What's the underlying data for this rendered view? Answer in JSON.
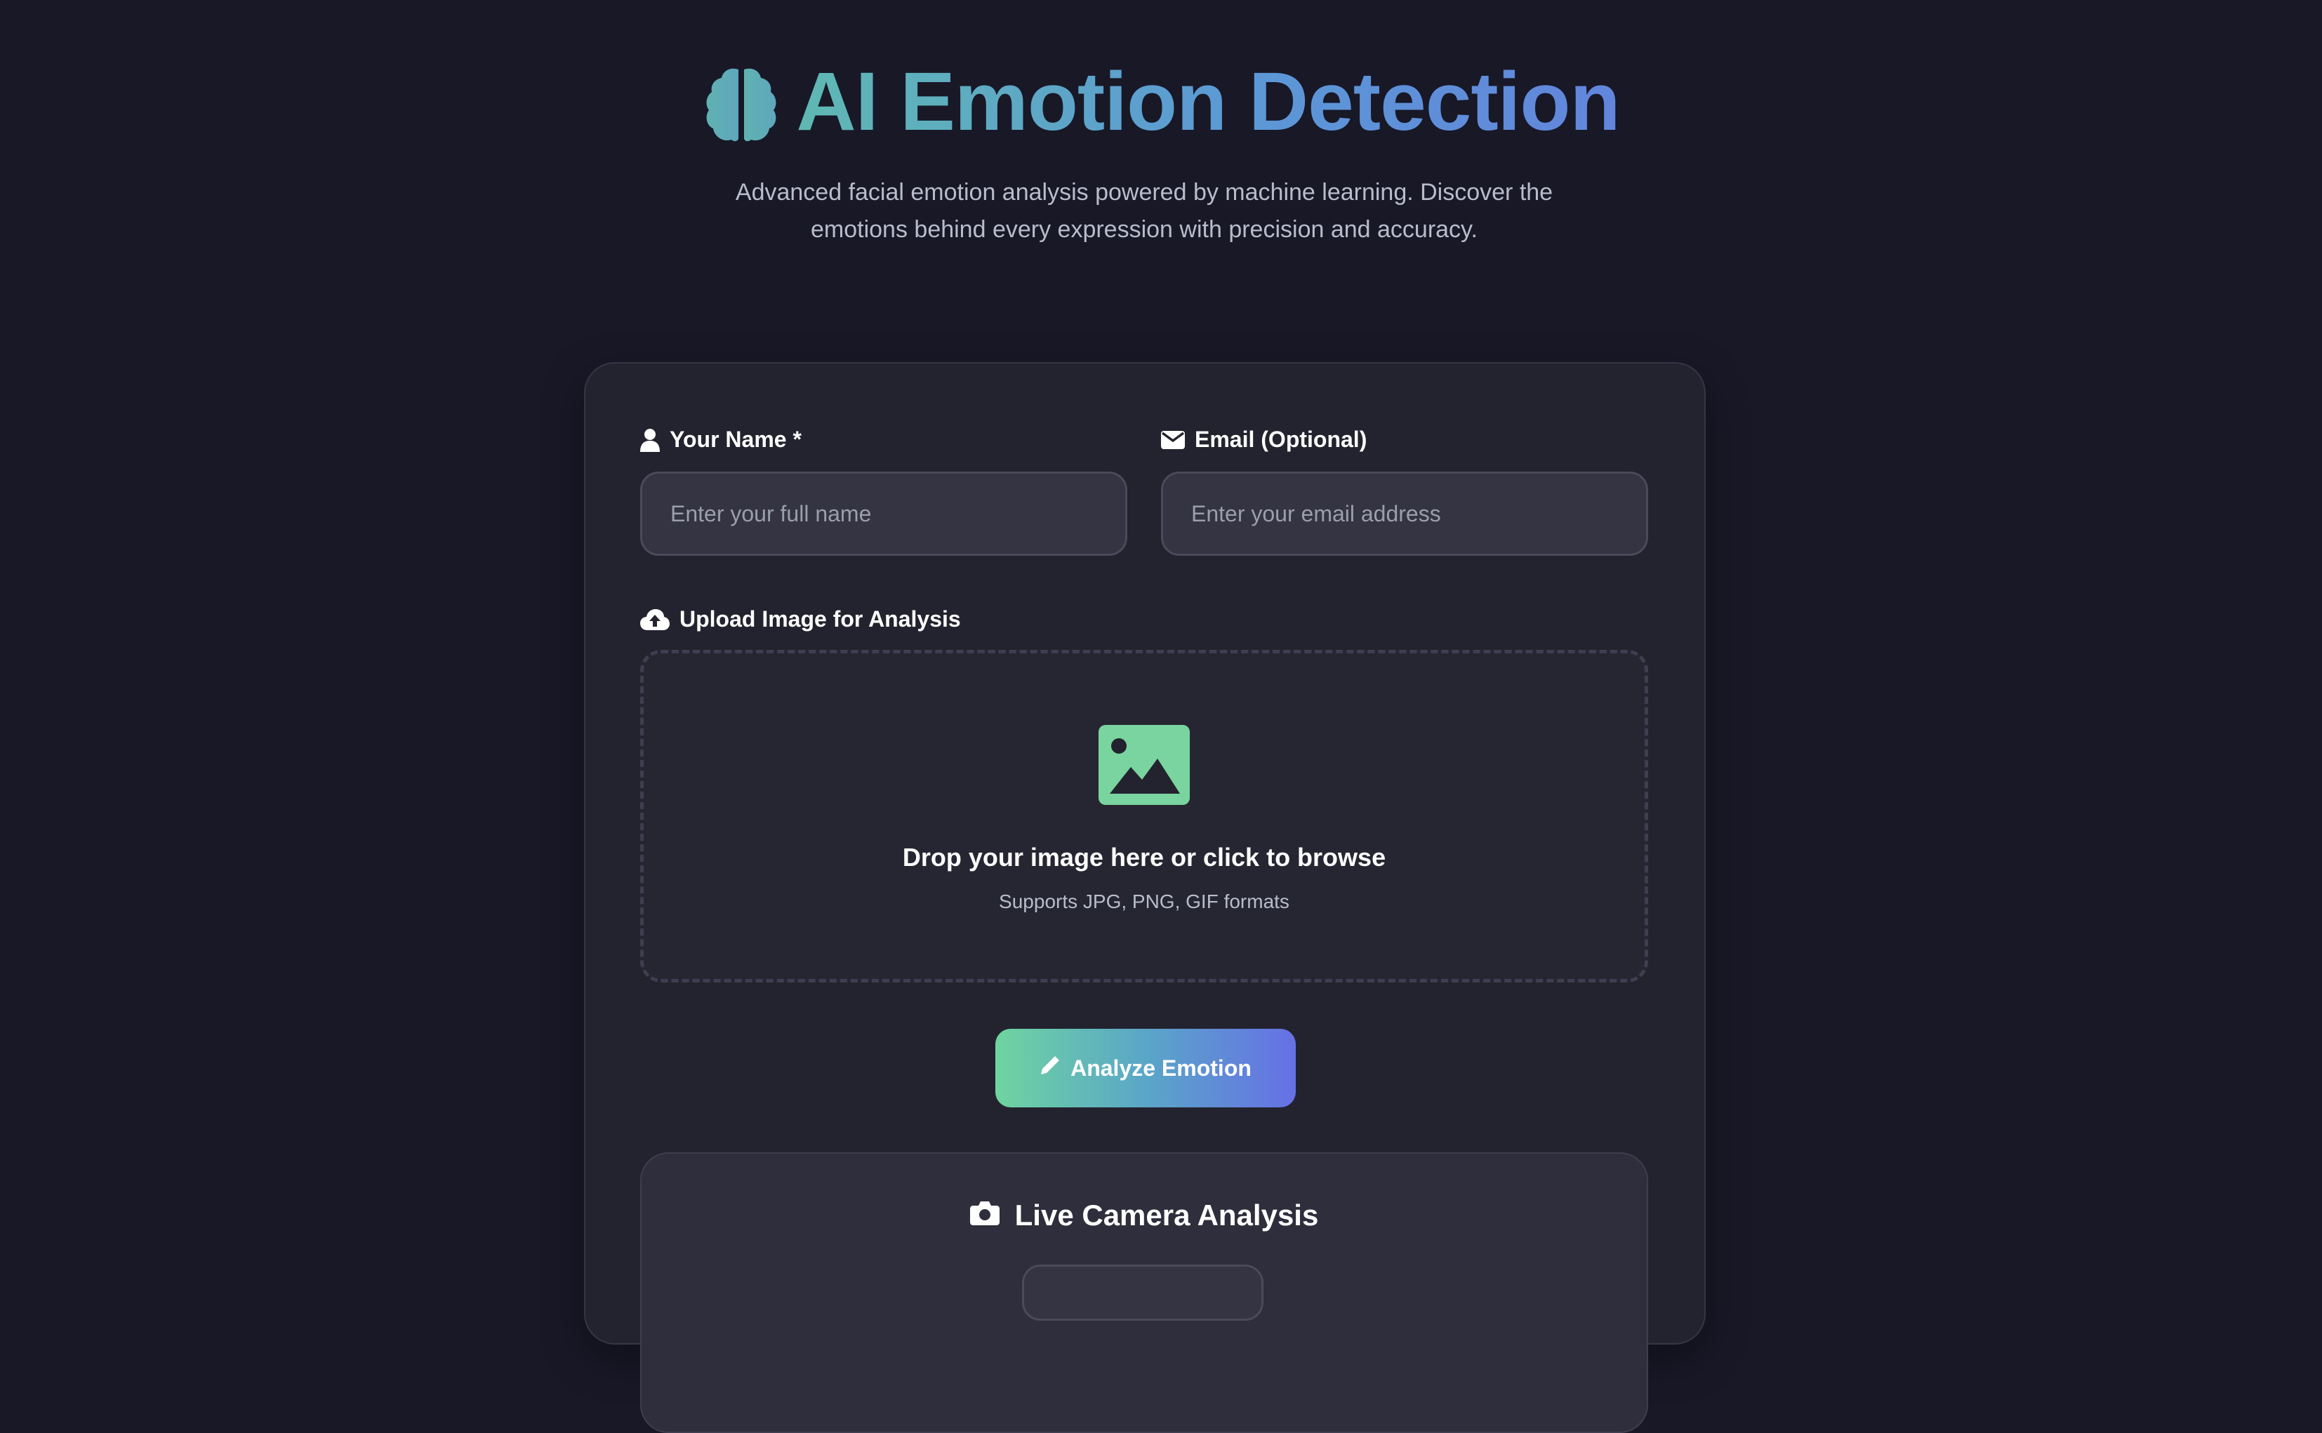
{
  "header": {
    "title": "AI Emotion Detection",
    "subtitle": "Advanced facial emotion analysis powered by machine learning. Discover the emotions behind every expression with precision and accuracy."
  },
  "form": {
    "name": {
      "label": "Your Name *",
      "placeholder": "Enter your full name",
      "icon": "user-icon"
    },
    "email": {
      "label": "Email (Optional)",
      "placeholder": "Enter your email address",
      "icon": "envelope-icon"
    },
    "upload": {
      "label": "Upload Image for Analysis",
      "icon": "cloud-upload-icon",
      "drop_title": "Drop your image here or click to browse",
      "drop_sub": "Supports JPG, PNG, GIF formats"
    },
    "analyze_button": "Analyze Emotion"
  },
  "camera": {
    "title": "Live Camera Analysis",
    "icon": "camera-icon"
  },
  "colors": {
    "background": "#181827",
    "card": "#23232f",
    "accent_green": "#6fd4a0",
    "accent_blue": "#6670e6",
    "title_teal": "#5fb8b3"
  }
}
